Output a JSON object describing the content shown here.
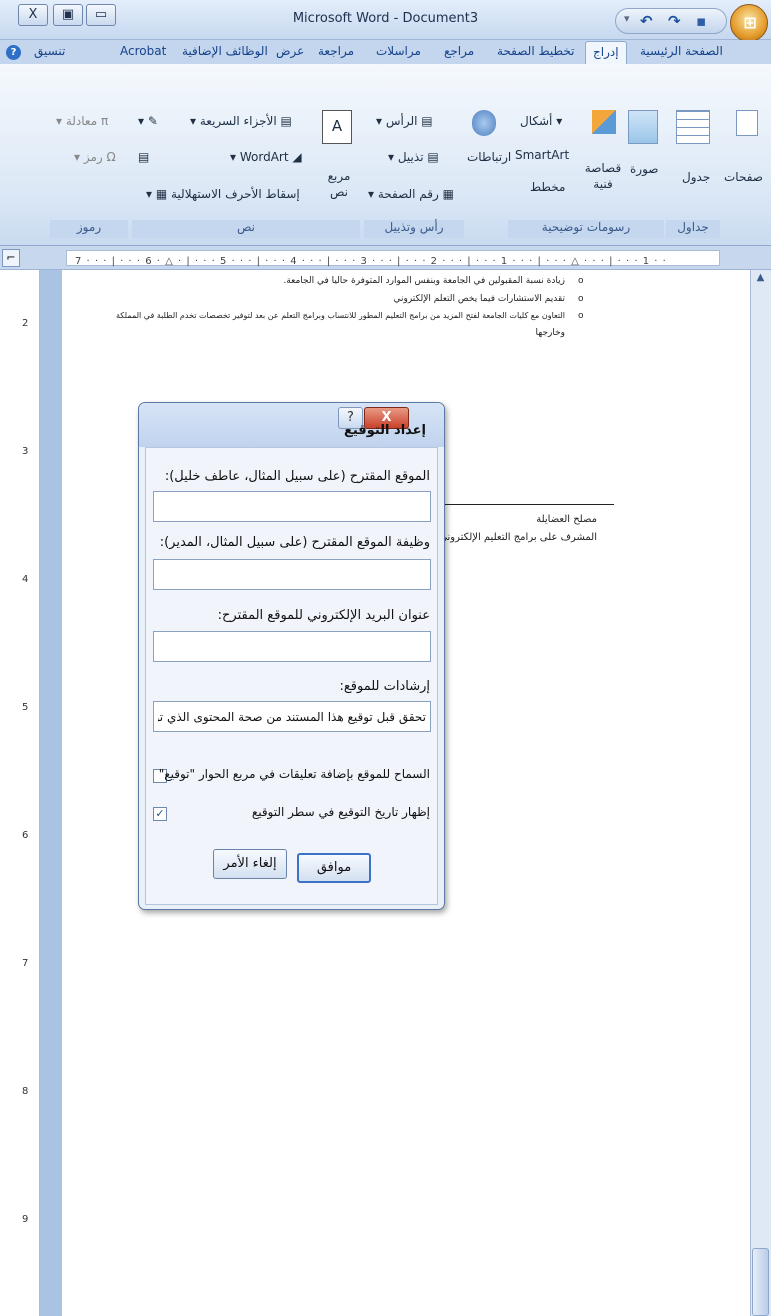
{
  "window": {
    "title": "Microsoft Word - Document3",
    "close_glyph": "X",
    "restore_glyph": "▣",
    "minimize_glyph": "▭",
    "undo_glyph": "↶",
    "redo_glyph": "↷",
    "save_glyph": "▪",
    "qat_menu_glyph": "▾",
    "office_glyph": "⊞"
  },
  "tabs": {
    "home": "الصفحة الرئيسية",
    "insert": "إدراج",
    "page_layout": "تخطيط الصفحة",
    "references": "مراجع",
    "mailings": "مراسلات",
    "review": "مراجعة",
    "view": "عرض",
    "addins": "الوظائف الإضافية",
    "acrobat": "Acrobat",
    "format": "تنسيق",
    "help_glyph": "?"
  },
  "ribbon": {
    "pages": "صفحات",
    "table": "جدول",
    "picture": "صورة",
    "clipart": "قصاصة فنية",
    "shapes": "أشكال",
    "smartart": "SmartArt",
    "chart": "مخطط",
    "links": "ارتباطات",
    "header": "الرأس",
    "footer": "تذييل",
    "page_number": "رقم الصفحة",
    "textbox": "مربع نص",
    "quick_parts": "الأجزاء السريعة",
    "wordart": "WordArt",
    "dropcap": "إسقاط الأحرف الاستهلالية",
    "equation": "معادلة",
    "symbol": "رمز",
    "groups": {
      "tables": "جداول",
      "illustrations": "رسومات توضيحية",
      "header_footer": "رأس وتذييل",
      "text": "نص",
      "symbols": "رموز"
    }
  },
  "ruler": {
    "numbers": "7 · · · | · · · 6 · △ · | · · · 5 · · · | · · · 4 · · · | · · · 3 · · · | · · · 2 · · · | · · · 1 · · · | · · · △ · · · | · · · 1 · ·",
    "vertical": [
      "2",
      "3",
      "4",
      "5",
      "6",
      "7",
      "8",
      "9"
    ]
  },
  "document": {
    "bullets": [
      "زيادة نسبة المقبولين في الجامعة وبنفس الموارد المتوفرة حاليا في الجامعة.",
      "تقديم الاستشارات فيما يخص التعلم الإلكتروني",
      "التعاون مع كليات الجامعة لفتح المزيد من برامج التعليم المطور للانتساب وبرامج التعلم عن بعد لتوفير تخصصات تخدم الطلبة في المملكة",
      "وخارجها"
    ],
    "bullet_glyph": "o",
    "signer_name": "مصلح العضايلة",
    "signer_title": "المشرف على برامج التعليم الإلكتروني"
  },
  "dialog": {
    "title": "إعداد التوقيع",
    "help_glyph": "?",
    "close_glyph": "X",
    "signer_label": "الموقع المقترح (على سبيل المثال، عاطف خليل):",
    "signer_value": "",
    "title_label": "وظيفة الموقع المقترح (على سبيل المثال، المدير):",
    "title_value": "",
    "email_label": "عنوان البريد الإلكتروني للموقع المقترح:",
    "email_value": "",
    "instructions_label": "إرشادات للموقع:",
    "instructions_value": "تحقق قبل توقيع هذا المستند من صحة المحتوى الذي توقعه.",
    "allow_comments_label": "السماح للموقع بإضافة تعليقات في مربع الحوار \"توقيع\"",
    "allow_comments_checked": false,
    "show_date_label": "إظهار تاريخ التوقيع في سطر التوقيع",
    "show_date_checked": true,
    "check_glyph": "✓",
    "ok": "موافق",
    "cancel": "إلغاء الأمر"
  },
  "colors": {
    "accent": "#15428b",
    "ribbon_bg": "#dce8f6",
    "close_red": "#c9412a"
  }
}
